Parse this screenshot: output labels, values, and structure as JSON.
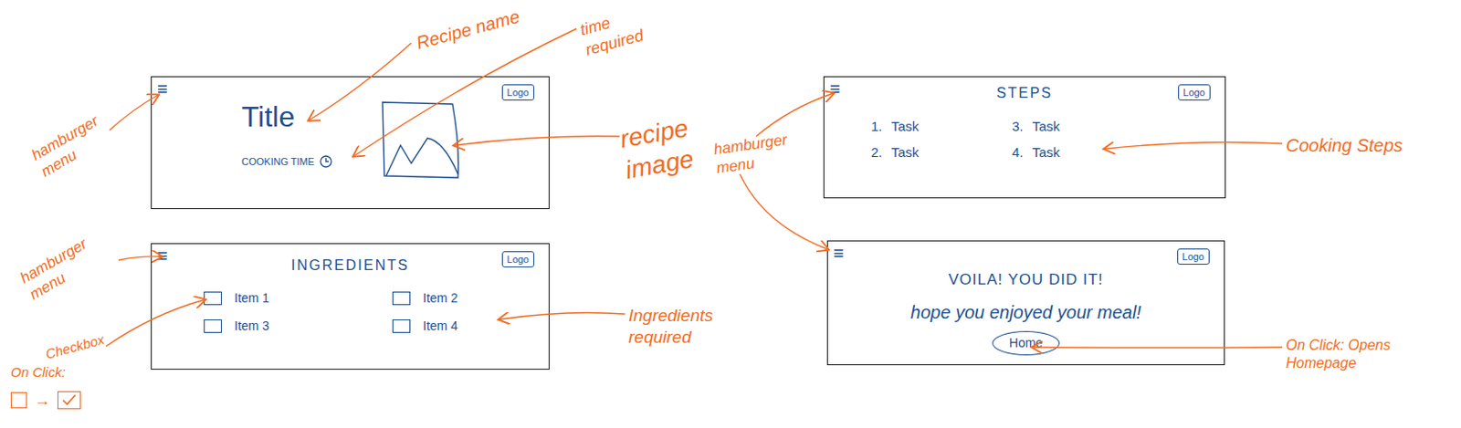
{
  "recipe_screen": {
    "menu": "≡",
    "logo": "Logo",
    "title": "Title",
    "cooking_time": "COOKING TIME"
  },
  "ingredients_screen": {
    "menu": "≡",
    "logo": "Logo",
    "heading": "INGREDIENTS",
    "items": [
      {
        "label": "Item 1",
        "checked": false
      },
      {
        "label": "Item 2",
        "checked": false
      },
      {
        "label": "Item 3",
        "checked": false
      },
      {
        "label": "Item 4",
        "checked": false
      }
    ]
  },
  "steps_screen": {
    "menu": "≡",
    "logo": "Logo",
    "heading": "STEPS",
    "steps": [
      {
        "number": "1.",
        "label": "Task"
      },
      {
        "number": "2.",
        "label": "Task"
      },
      {
        "number": "3.",
        "label": "Task"
      },
      {
        "number": "4.",
        "label": "Task"
      }
    ]
  },
  "done_screen": {
    "menu": "≡",
    "logo": "Logo",
    "title": "VOILA! YOU DID IT!",
    "message": "hope you enjoyed your meal!",
    "button": "Home"
  },
  "annotations": [
    {
      "text": "Recipe name"
    },
    {
      "text": "time required"
    },
    {
      "text": "hamburger menu"
    },
    {
      "text": "recipe image"
    },
    {
      "text": "hamburger menu"
    },
    {
      "text": "Cooking Steps"
    },
    {
      "text": "hamburger menu"
    },
    {
      "text": "Checkbox"
    },
    {
      "text": "Ingredients required"
    },
    {
      "text": "On Click: Opens Homepage"
    }
  ],
  "click_demo": {
    "label": "On Click:",
    "arrow": "→",
    "before_checked": false,
    "after_checked": true
  }
}
